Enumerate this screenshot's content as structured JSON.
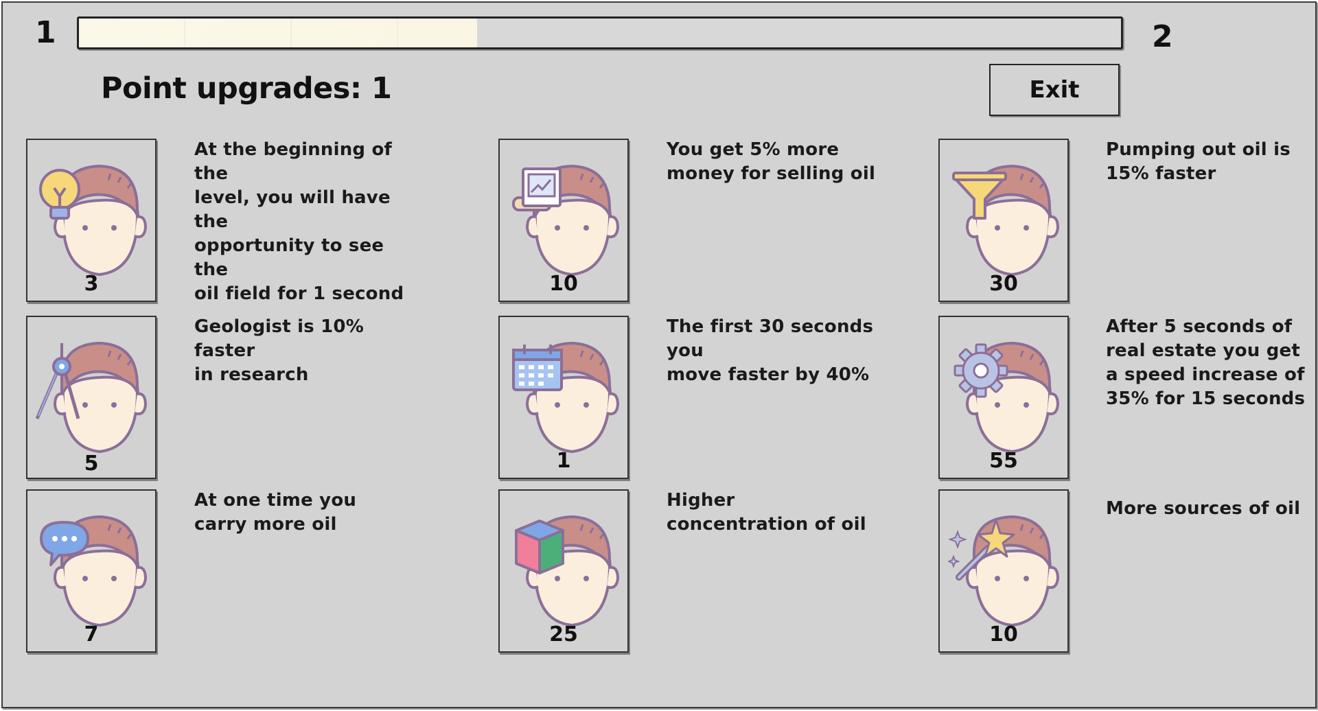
{
  "level": {
    "current": "1",
    "next": "2",
    "progress_fraction": 0.382
  },
  "header": {
    "title": "Point upgrades: 1",
    "exit_label": "Exit"
  },
  "upgrades": [
    {
      "icon": "lightbulb-icon",
      "cost": "3",
      "description": "At the beginning of the\nlevel, you will have the\nopportunity to see the\noil field for 1 second"
    },
    {
      "icon": "chart-document-icon",
      "cost": "10",
      "description": "You get 5% more\nmoney for selling oil"
    },
    {
      "icon": "funnel-icon",
      "cost": "30",
      "description": "Pumping out oil is\n15% faster"
    },
    {
      "icon": "compass-icon",
      "cost": "5",
      "description": "Geologist is 10% faster\nin research"
    },
    {
      "icon": "calendar-icon",
      "cost": "1",
      "description": "The first 30 seconds you\nmove faster by 40%"
    },
    {
      "icon": "gear-icon",
      "cost": "55",
      "description": "After 5 seconds of\nreal estate you get\na speed increase of\n35% for 15 seconds"
    },
    {
      "icon": "speech-bubble-icon",
      "cost": "7",
      "description": "At one time you\ncarry more oil"
    },
    {
      "icon": "cube-icon",
      "cost": "25",
      "description": "Higher\nconcentration of oil"
    },
    {
      "icon": "magic-wand-icon",
      "cost": "10",
      "description": "More sources of oil"
    }
  ],
  "colors": {
    "panel_bg": "#d3d3d3",
    "progress_fill": "#fbf7e6",
    "skin": "#fceedd",
    "hair": "#c98e88",
    "outline": "#8b6f98"
  }
}
